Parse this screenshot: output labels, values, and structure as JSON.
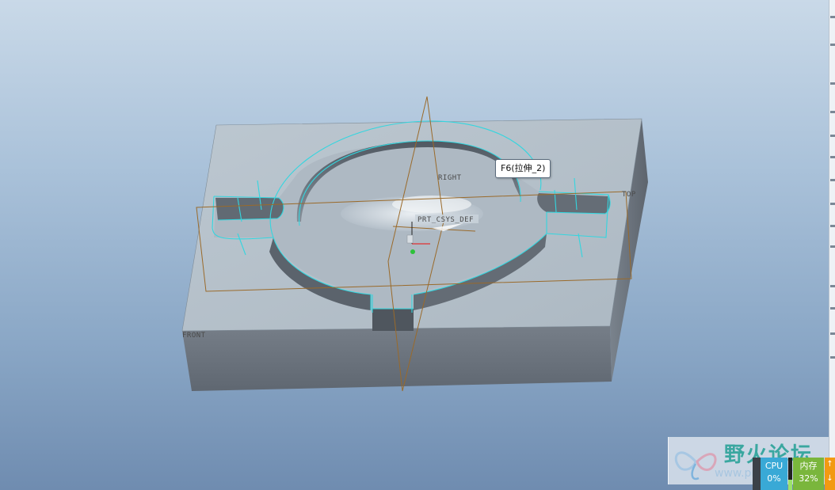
{
  "tooltip": {
    "text": "F6(拉伸_2)"
  },
  "datums": {
    "right": "RIGHT",
    "top": "TOP",
    "front": "FRONT",
    "csys": "PRT_CSYS_DEF"
  },
  "watermark": {
    "title": "野火论坛",
    "url": "www.proewildfire.cn"
  },
  "monitor": {
    "cpu_label": "CPU",
    "cpu_value": "0%",
    "mem_label": "内存",
    "mem_value": "32%",
    "mem_fraction": 0.32,
    "net_up": "↑",
    "net_down": "↓"
  },
  "colors": {
    "highlight": "#33d6df",
    "datum": "#9a6a2a",
    "part_top": "#b7c3cd",
    "part_side": "#6e7680"
  }
}
